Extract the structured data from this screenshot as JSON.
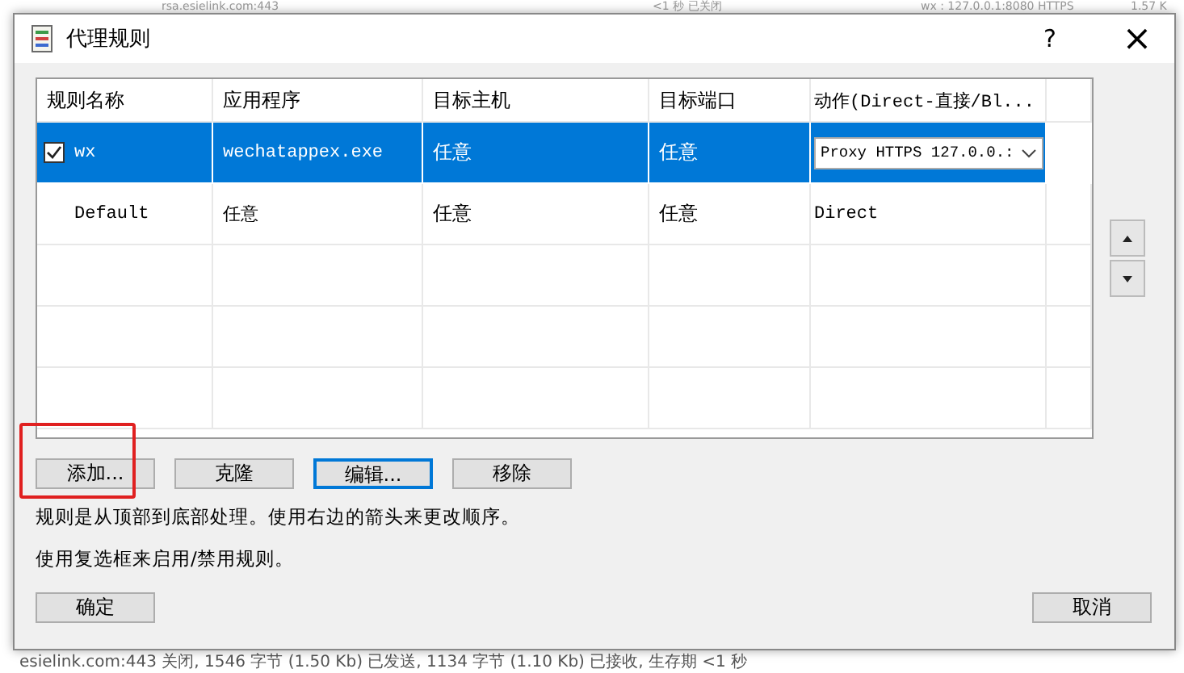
{
  "background_window": {
    "top_row": [
      "rsa.esielink.com:443",
      "<1 秒 已关闭",
      "wx : 127.0.0.1:8080 HTTPS",
      "1.57 K"
    ],
    "bottom_line": "esielink.com:443 关闭, 1546 字节 (1.50 Kb) 已发送, 1134 字节 (1.10 Kb) 已接收, 生存期 <1 秒"
  },
  "dialog": {
    "title": "代理规则",
    "help": "?",
    "close": "×"
  },
  "table": {
    "columns": [
      "规则名称",
      "应用程序",
      "目标主机",
      "目标端口",
      "动作(Direct-直接/Bl..."
    ],
    "rows": [
      {
        "selected": true,
        "checked": true,
        "name": "wx",
        "app": "wechatappex.exe",
        "host": "任意",
        "port": "任意",
        "action": "Proxy HTTPS 127.0.0.:",
        "kind": "dropdown"
      },
      {
        "selected": false,
        "checked": false,
        "name": "Default",
        "app": "任意",
        "host": "任意",
        "port": "任意",
        "action": "Direct",
        "kind": "text"
      }
    ]
  },
  "buttons": [
    {
      "label": "添加...",
      "highlighted": true,
      "focused": false
    },
    {
      "label": "克隆",
      "highlighted": false,
      "focused": false
    },
    {
      "label": "编辑...",
      "highlighted": false,
      "focused": true
    },
    {
      "label": "移除",
      "highlighted": false,
      "focused": false
    }
  ],
  "notes": [
    "规则是从顶部到底部处理。使用右边的箭头来更改顺序。",
    "使用复选框来启用/禁用规则。"
  ],
  "ok_button": "确定",
  "cancel_button": "取消"
}
